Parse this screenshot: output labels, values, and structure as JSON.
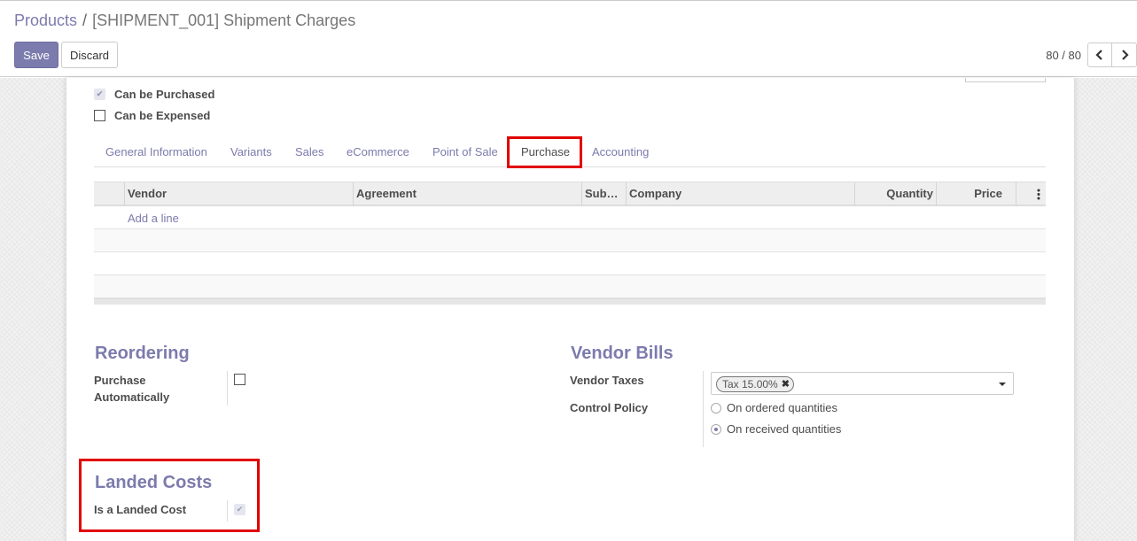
{
  "breadcrumb": {
    "parent": "Products",
    "separator": "/",
    "current": "[SHIPMENT_001] Shipment Charges"
  },
  "buttons": {
    "save": "Save",
    "discard": "Discard"
  },
  "pager": {
    "value": "80 / 80"
  },
  "checkboxes": {
    "can_be_purchased": "Can be Purchased",
    "can_be_expensed": "Can be Expensed"
  },
  "tabs": [
    "General Information",
    "Variants",
    "Sales",
    "eCommerce",
    "Point of Sale",
    "Purchase",
    "Accounting"
  ],
  "active_tab": "Purchase",
  "vendor_table": {
    "columns": [
      "Vendor",
      "Agreement",
      "Sub…",
      "Company",
      "Quantity",
      "Price"
    ],
    "add_line": "Add a line"
  },
  "reordering": {
    "title": "Reordering",
    "purchase_auto_label": "Purchase Automatically"
  },
  "vendor_bills": {
    "title": "Vendor Bills",
    "taxes_label": "Vendor Taxes",
    "tax_tag": "Tax 15.00%",
    "control_policy_label": "Control Policy",
    "options": [
      "On ordered quantities",
      "On received quantities"
    ],
    "selected_option": "On received quantities"
  },
  "landed_costs": {
    "title": "Landed Costs",
    "is_landed_cost_label": "Is a Landed Cost"
  },
  "colors": {
    "accent": "#7c7bad",
    "highlight": "#e10000"
  }
}
